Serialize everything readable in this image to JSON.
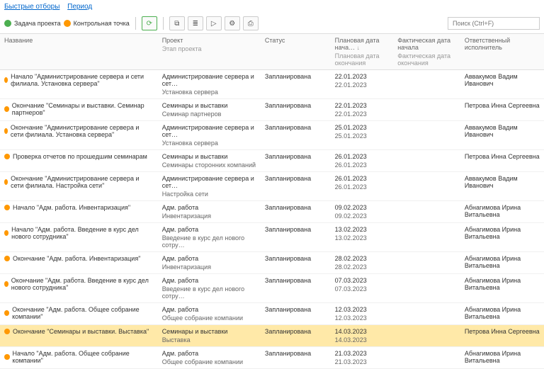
{
  "topLinks": {
    "quick": "Быстрые отборы",
    "period": "Период"
  },
  "legend": {
    "task": "Задача проекта",
    "checkpoint": "Контрольная точка"
  },
  "search": {
    "placeholder": "Поиск (Ctrl+F)"
  },
  "columns": {
    "name": "Название",
    "project": "Проект",
    "projectSub": "Этап проекта",
    "status": "Статус",
    "planStart": "Плановая дата нача…",
    "planStartSub": "Плановая дата окончания",
    "factStart": "Фактическая дата начала",
    "factStartSub": "Фактическая дата окончания",
    "responsible": "Ответственный исполнитель",
    "sort": "↓"
  },
  "rows": [
    {
      "name": "Начало \"Администрирование сервера и сети филиала. Установка сервера\"",
      "project": "Администрирование сервера и сет…",
      "stage": "Установка сервера",
      "status": "Запланирована",
      "d1": "22.01.2023",
      "d2": "22.01.2023",
      "resp": "Аввакумов Вадим Иванович",
      "hl": false
    },
    {
      "name": "Окончание \"Семинары и выставки. Семинар партнеров\"",
      "project": "Семинары и выставки",
      "stage": "Семинар партнеров",
      "status": "Запланирована",
      "d1": "22.01.2023",
      "d2": "22.01.2023",
      "resp": "Петрова Инна Сергеевна",
      "hl": false
    },
    {
      "name": "Окончание \"Администрирование сервера и сети филиала. Установка сервера\"",
      "project": "Администрирование сервера и сет…",
      "stage": "Установка сервера",
      "status": "Запланирована",
      "d1": "25.01.2023",
      "d2": "25.01.2023",
      "resp": "Аввакумов Вадим Иванович",
      "hl": false
    },
    {
      "name": "Проверка отчетов по прошедшим семинарам",
      "project": "Семинары и выставки",
      "stage": "Семинары сторонних компаний",
      "status": "Запланирована",
      "d1": "26.01.2023",
      "d2": "26.01.2023",
      "resp": "Петрова Инна Сергеевна",
      "hl": false
    },
    {
      "name": "Окончание \"Администрирование сервера и сети филиала. Настройка сети\"",
      "project": "Администрирование сервера и сет…",
      "stage": "Настройка сети",
      "status": "Запланирована",
      "d1": "26.01.2023",
      "d2": "26.01.2023",
      "resp": "Аввакумов Вадим Иванович",
      "hl": false
    },
    {
      "name": "Начало \"Адм. работа. Инвентаризация\"",
      "project": "Адм. работа",
      "stage": "Инвентаризация",
      "status": "Запланирована",
      "d1": "09.02.2023",
      "d2": "09.02.2023",
      "resp": "Абнагимова Ирина Витальевна",
      "hl": false
    },
    {
      "name": "Начало \"Адм. работа. Введение в курс дел нового сотрудника\"",
      "project": "Адм. работа",
      "stage": "Введение в курс дел нового сотру…",
      "status": "Запланирована",
      "d1": "13.02.2023",
      "d2": "13.02.2023",
      "resp": "Абнагимова Ирина Витальевна",
      "hl": false
    },
    {
      "name": "Окончание \"Адм. работа. Инвентаризация\"",
      "project": "Адм. работа",
      "stage": "Инвентаризация",
      "status": "Запланирована",
      "d1": "28.02.2023",
      "d2": "28.02.2023",
      "resp": "Абнагимова Ирина Витальевна",
      "hl": false
    },
    {
      "name": "Окончание \"Адм. работа. Введение в курс дел нового сотрудника\"",
      "project": "Адм. работа",
      "stage": "Введение в курс дел нового сотру…",
      "status": "Запланирована",
      "d1": "07.03.2023",
      "d2": "07.03.2023",
      "resp": "Абнагимова Ирина Витальевна",
      "hl": false
    },
    {
      "name": "Окончание \"Адм. работа. Общее собрание компании\"",
      "project": "Адм. работа",
      "stage": "Общее собрание компании",
      "status": "Запланирована",
      "d1": "12.03.2023",
      "d2": "12.03.2023",
      "resp": "Абнагимова Ирина Витальевна",
      "hl": false
    },
    {
      "name": "Окончание \"Семинары и выставки. Выставка\"",
      "project": "Семинары и выставки",
      "stage": "Выставка",
      "status": "Запланирована",
      "d1": "14.03.2023",
      "d2": "14.03.2023",
      "resp": "Петрова Инна Сергеевна",
      "hl": true
    },
    {
      "name": "Начало \"Адм. работа. Общее собрание компании\"",
      "project": "Адм. работа",
      "stage": "Общее собрание компании",
      "status": "Запланирована",
      "d1": "21.03.2023",
      "d2": "21.03.2023",
      "resp": "Абнагимова Ирина Витальевна",
      "hl": false
    }
  ]
}
